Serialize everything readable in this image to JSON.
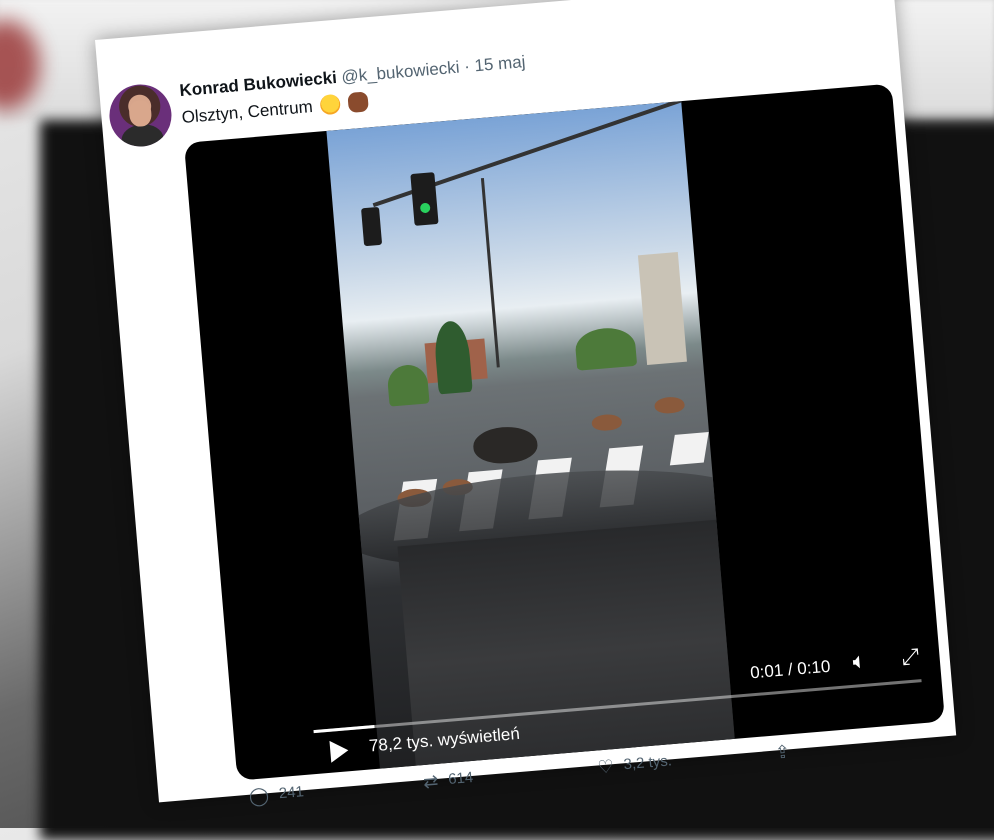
{
  "tweet": {
    "author_name": "Konrad Bukowiecki",
    "handle": "@k_bukowiecki",
    "separator": "·",
    "date": "15 maj",
    "text": "Olsztyn, Centrum",
    "emojis": [
      "flushed-face",
      "boar"
    ]
  },
  "video": {
    "time": "0:01 / 0:10",
    "views": "78,2 tys. wyświetleń",
    "progress": 0.1
  },
  "actions": {
    "replies": "241",
    "retweets": "614",
    "likes": "3,2 tys."
  },
  "icons": {
    "reply": "comment-icon",
    "retweet": "retweet-icon",
    "like": "heart-icon",
    "share": "share-icon",
    "play": "play-icon",
    "volume": "volume-icon",
    "fullscreen": "expand-icon",
    "menu": "chevron-down-icon"
  }
}
